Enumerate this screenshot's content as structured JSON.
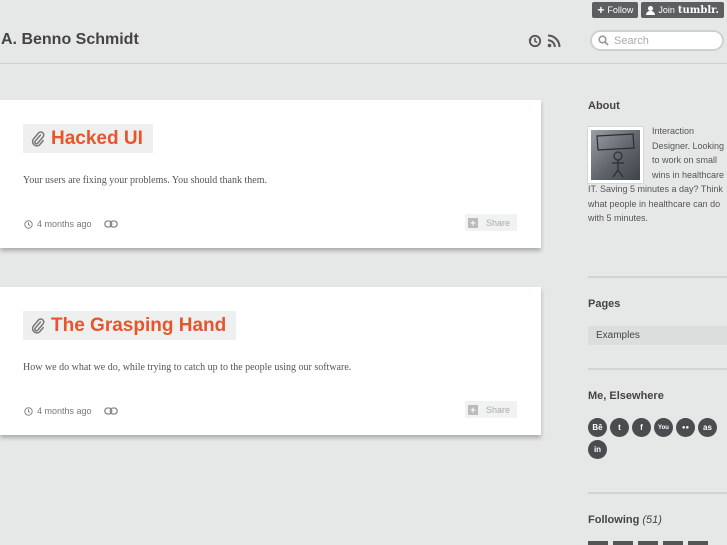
{
  "tumblr_controls": {
    "follow_label": "Follow",
    "join_label": "Join",
    "join_brand": "tumblr."
  },
  "header": {
    "blog_title": "A. Benno Schmidt",
    "search_placeholder": "Search",
    "icons": [
      "history-icon",
      "rss-icon",
      "search-icon"
    ]
  },
  "posts": [
    {
      "title": "Hacked UI",
      "body": "Your users are fixing your problems. You should thank them.",
      "time": "4 months ago",
      "share_label": "Share"
    },
    {
      "title": "The Grasping Hand",
      "body": "How we do what we do, while trying to catch up to the people using our software.",
      "time": "4 months ago",
      "share_label": "Share"
    }
  ],
  "sidebar": {
    "about": {
      "heading": "About",
      "text": "Interaction Designer. Looking to work on small wins in healthcare IT. Saving 5 minutes a day? Think what people in healthcare can do with 5 minutes."
    },
    "pages": {
      "heading": "Pages",
      "items": [
        {
          "label": "Examples"
        }
      ]
    },
    "elsewhere": {
      "heading": "Me, Elsewhere",
      "icons": [
        {
          "name": "behance-icon",
          "glyph": "Bē"
        },
        {
          "name": "twitter-icon",
          "glyph": "t"
        },
        {
          "name": "facebook-icon",
          "glyph": "f"
        },
        {
          "name": "youtube-icon",
          "glyph": "You"
        },
        {
          "name": "flickr-icon",
          "glyph": "●●"
        },
        {
          "name": "lastfm-icon",
          "glyph": "as"
        },
        {
          "name": "linkedin-icon",
          "glyph": "in"
        }
      ]
    },
    "following": {
      "heading": "Following",
      "count": "(51)"
    }
  },
  "colors": {
    "accent": "#e8552c",
    "background": "#e6e8e7",
    "dark_ui": "#5c5f60"
  }
}
